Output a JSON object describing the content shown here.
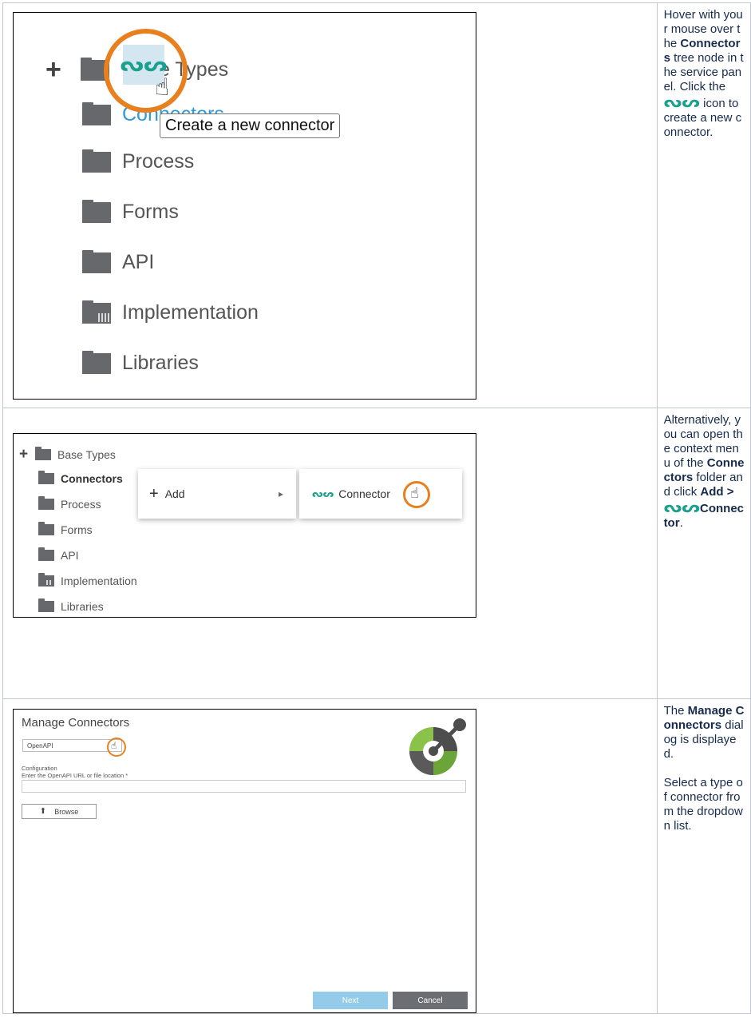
{
  "step1": {
    "tree": {
      "add_sign": "+",
      "items": [
        "Base Types",
        "Connectors",
        "Process",
        "Forms",
        "API",
        "Implementation",
        "Libraries"
      ],
      "base_types_visible": "e Types",
      "connectors_visible": "Connectors"
    },
    "tooltip": "Create a new connector",
    "description": {
      "p1": "Hover with your mouse over the ",
      "bold1": "Connectors",
      "p2": " tree node in the service panel. Click the ",
      "p3": " icon to create a new connector."
    }
  },
  "step2": {
    "tree": {
      "add_sign": "+",
      "items": [
        "Base Types",
        "Connectors",
        "Process",
        "Forms",
        "API",
        "Implementation",
        "Libraries"
      ]
    },
    "context_menu": {
      "add_label": "Add",
      "plus": "+",
      "arrow": "▸",
      "connector_label": "Connector"
    },
    "description": {
      "p1": "Alternatively, you can open the context menu of the ",
      "bold1": "Connectors",
      "p2": " folder and click ",
      "bold2": "Add > ",
      "bold3": "Connector",
      "p3": "."
    }
  },
  "step3": {
    "dialog": {
      "title": "Manage Connectors",
      "select_value": "OpenAPI",
      "configuration_label": "Configuration",
      "url_label": "Enter the OpenAPI URL or file location *",
      "url_value": "",
      "browse_label": "Browse",
      "next_label": "Next",
      "cancel_label": "Cancel"
    },
    "description": {
      "p0": "The ",
      "bold1": "Manage Connectors",
      "p1": " dialog is displayed.",
      "p2": "Select a type of connector from the dropdown list."
    }
  },
  "colors": {
    "accent_orange": "#e8801f",
    "connector_teal": "#1aa08c",
    "folder_gray": "#66686b",
    "next_button": "#93cbe8",
    "cancel_button": "#6b6e72"
  },
  "icons": {
    "connector": "connector-icon",
    "folder": "folder-icon",
    "hand": "hand-pointer-icon",
    "upload": "upload-icon",
    "logo": "openapi-logo"
  }
}
